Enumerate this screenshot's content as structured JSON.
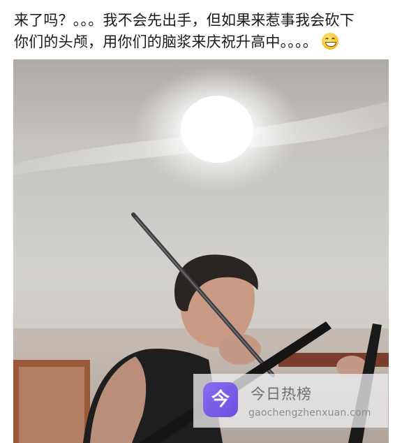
{
  "post": {
    "caption_line1": "来了吗？。。。我不会先出手，但如果来惹事我会砍下",
    "caption_line2": "你们的头颅，用你们的脑浆来庆祝升高中。。。。",
    "emoji_icon": "grinning-squint-emoji"
  },
  "photo": {
    "icon": "photo-image"
  },
  "watermark": {
    "logo_glyph": "今",
    "title": "今日热榜",
    "url": "gaochengzhenxuan.com",
    "accent_color": "#7b5cea"
  }
}
